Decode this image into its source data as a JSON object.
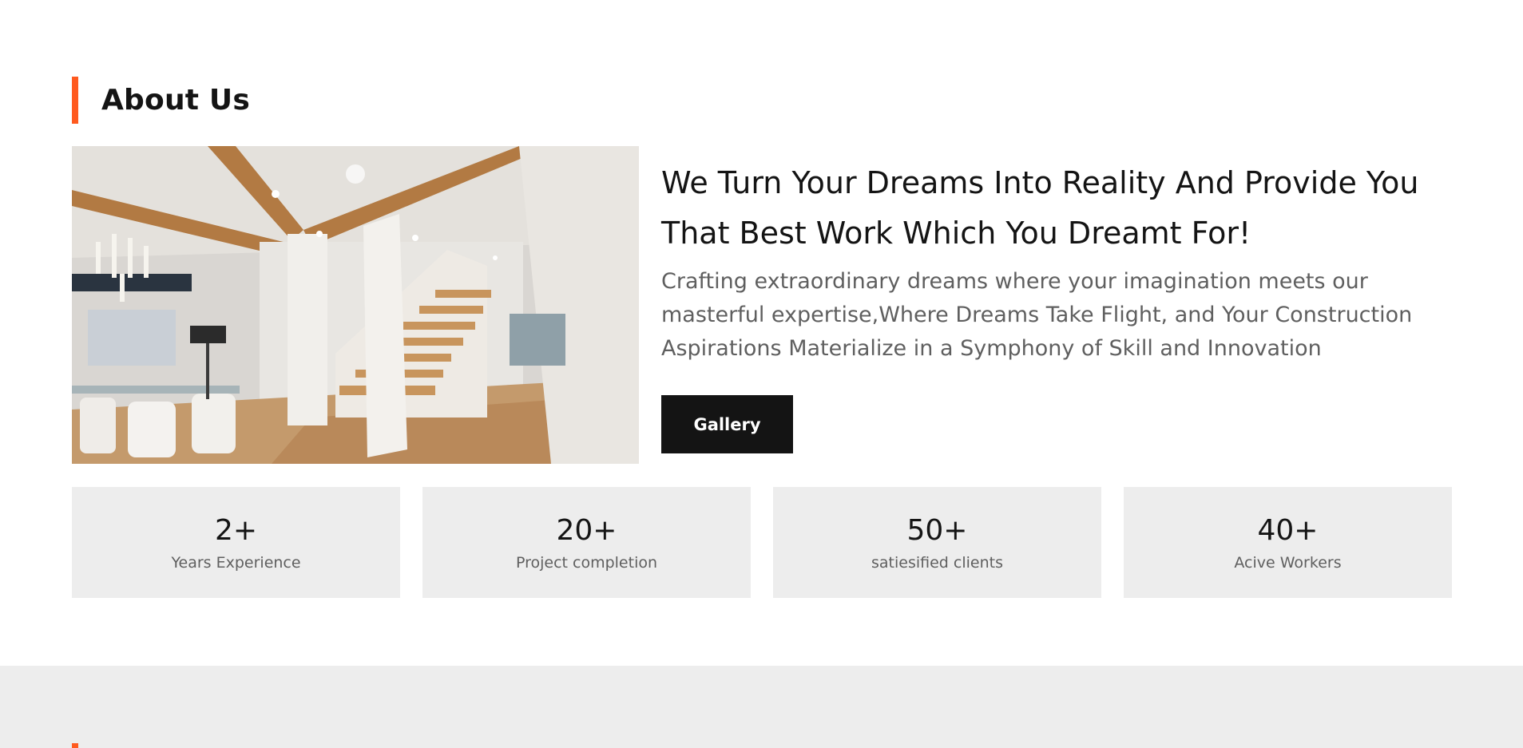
{
  "about": {
    "heading": "About Us",
    "title": "We Turn Your Dreams Into Reality And Provide You That Best Work Which You Dreamt For!",
    "description": "Crafting extraordinary dreams where your imagination meets our masterful expertise,Where Dreams Take Flight, and Your Construction Aspirations Materialize in a Symphony of Skill and Innovation",
    "gallery_button": "Gallery",
    "accent_color": "#ff5a1f"
  },
  "stats": [
    {
      "value": "2+",
      "label": "Years Experience"
    },
    {
      "value": "20+",
      "label": "Project completion"
    },
    {
      "value": "50+",
      "label": "satiesified clients"
    },
    {
      "value": "40+",
      "label": "Acive Workers"
    }
  ]
}
